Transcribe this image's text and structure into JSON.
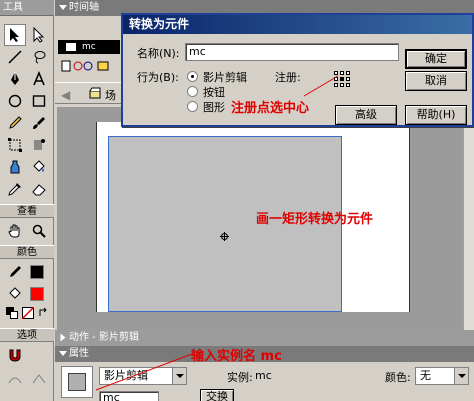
{
  "toolbar": {
    "title": "工具",
    "view_label": "查看",
    "colors_label": "颜色",
    "options_label": "选项"
  },
  "timeline": {
    "title": "时间轴",
    "layer_name": "mc",
    "scene_label": "场"
  },
  "dialog": {
    "title": "转换为元件",
    "name_label": "名称(N):",
    "name_value": "mc",
    "behavior_label": "行为(B):",
    "options": [
      "影片剪辑",
      "按钮",
      "图形"
    ],
    "selected_option": "影片剪辑",
    "registration_label": "注册:",
    "ok_button": "确定",
    "cancel_button": "取消",
    "advanced_button": "高级",
    "help_button": "帮助(H)"
  },
  "panels": {
    "actions_title": "动作 - 影片剪辑",
    "properties_title": "属性",
    "symbol_type": "影片剪辑",
    "instance_label": "实例:",
    "instance_value": "mc",
    "color_label": "颜色:",
    "color_value": "无",
    "instance_name_field": "mc",
    "swap_button": "交换"
  },
  "annotations": {
    "reg_center": "注册点选中心",
    "draw_rect": "画一矩形转换为元件",
    "instance_name": "输入实例名 mc"
  },
  "colors": {
    "annotation": "#e00000",
    "dialog_title": "#0a246a",
    "fill_swatch": "#ff0000"
  }
}
